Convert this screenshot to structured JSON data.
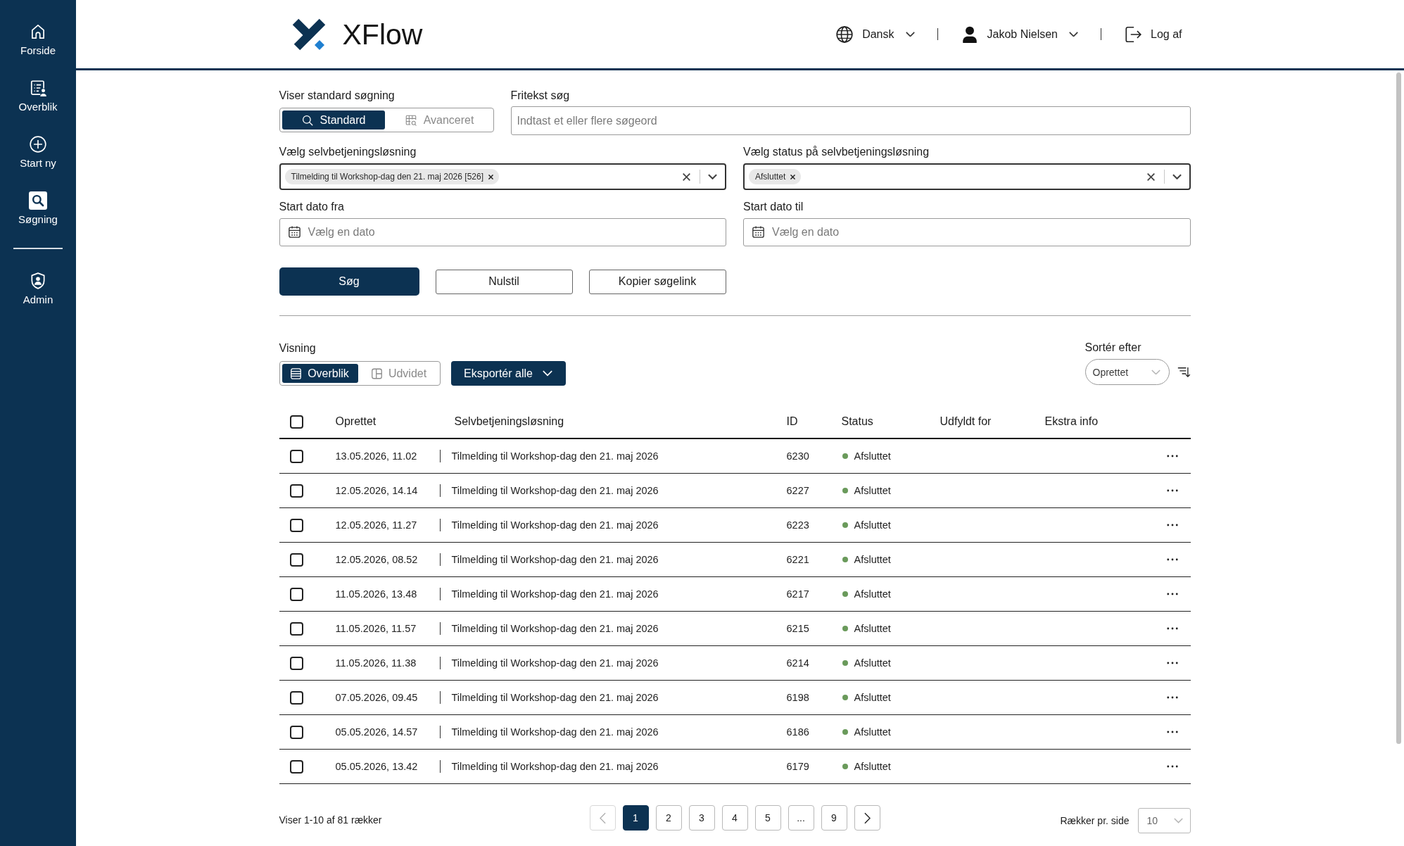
{
  "sidebar": {
    "items": [
      {
        "label": "Forside",
        "selected": false
      },
      {
        "label": "Overblik",
        "selected": false
      },
      {
        "label": "Start ny",
        "selected": false
      },
      {
        "label": "Søgning",
        "selected": true
      }
    ],
    "bottom_items": [
      {
        "label": "Admin",
        "selected": false
      }
    ]
  },
  "header": {
    "logo": "XFlow",
    "language": "Dansk",
    "user": "Jakob Nielsen",
    "logout": "Log af"
  },
  "search_form": {
    "mode_toggle": {
      "label": "Viser standard søgning",
      "options": [
        {
          "label": "Standard",
          "selected": true
        },
        {
          "label": "Avanceret",
          "selected": false
        }
      ]
    },
    "free_text": {
      "label": "Fritekst søg",
      "placeholder": "Indtast et eller flere søgeord"
    },
    "solution_select": {
      "label": "Vælg selvbetjeningsløsning",
      "chips": [
        "Tilmelding til Workshop-dag den 21. maj 2026 [526]"
      ]
    },
    "status_select": {
      "label": "Vælg status på selvbetjeningsløsning",
      "chips": [
        "Afsluttet"
      ]
    },
    "date_from": {
      "label": "Start dato fra",
      "placeholder": "Vælg en dato"
    },
    "date_to": {
      "label": "Start dato til",
      "placeholder": "Vælg en dato"
    },
    "buttons": [
      {
        "label": "Søg",
        "kind": "primary"
      },
      {
        "label": "Nulstil",
        "kind": "secondary"
      },
      {
        "label": "Kopier søgelink",
        "kind": "secondary"
      }
    ]
  },
  "results": {
    "view_toggle": {
      "label": "Visning",
      "options": [
        {
          "label": "Overblik",
          "selected": true
        },
        {
          "label": "Udvidet",
          "selected": false
        }
      ]
    },
    "export_button": "Eksportér alle",
    "sort": {
      "label": "Sortér efter",
      "value": "Oprettet"
    },
    "table": {
      "columns": [
        "Oprettet",
        "Selvbetjeningsløsning",
        "ID",
        "Status",
        "Udfyldt for",
        "Ekstra info"
      ],
      "all_checked": false,
      "rows": [
        {
          "checked": false,
          "created": "13.05.2026, 11.02",
          "solution": "Tilmelding til Workshop-dag den 21. maj 2026",
          "id": "6230",
          "status": "Afsluttet"
        },
        {
          "checked": false,
          "created": "12.05.2026, 14.14",
          "solution": "Tilmelding til Workshop-dag den 21. maj 2026",
          "id": "6227",
          "status": "Afsluttet"
        },
        {
          "checked": false,
          "created": "12.05.2026, 11.27",
          "solution": "Tilmelding til Workshop-dag den 21. maj 2026",
          "id": "6223",
          "status": "Afsluttet"
        },
        {
          "checked": false,
          "created": "12.05.2026, 08.52",
          "solution": "Tilmelding til Workshop-dag den 21. maj 2026",
          "id": "6221",
          "status": "Afsluttet"
        },
        {
          "checked": false,
          "created": "11.05.2026, 13.48",
          "solution": "Tilmelding til Workshop-dag den 21. maj 2026",
          "id": "6217",
          "status": "Afsluttet"
        },
        {
          "checked": false,
          "created": "11.05.2026, 11.57",
          "solution": "Tilmelding til Workshop-dag den 21. maj 2026",
          "id": "6215",
          "status": "Afsluttet"
        },
        {
          "checked": false,
          "created": "11.05.2026, 11.38",
          "solution": "Tilmelding til Workshop-dag den 21. maj 2026",
          "id": "6214",
          "status": "Afsluttet"
        },
        {
          "checked": false,
          "created": "07.05.2026, 09.45",
          "solution": "Tilmelding til Workshop-dag den 21. maj 2026",
          "id": "6198",
          "status": "Afsluttet"
        },
        {
          "checked": false,
          "created": "05.05.2026, 14.57",
          "solution": "Tilmelding til Workshop-dag den 21. maj 2026",
          "id": "6186",
          "status": "Afsluttet"
        },
        {
          "checked": false,
          "created": "05.05.2026, 13.42",
          "solution": "Tilmelding til Workshop-dag den 21. maj 2026",
          "id": "6179",
          "status": "Afsluttet"
        }
      ]
    }
  },
  "pagination": {
    "summary": "Viser 1-10 af 81 rækker",
    "prev": {
      "disabled": true
    },
    "pages": [
      {
        "label": "1",
        "selected": true
      },
      {
        "label": "2",
        "selected": false
      },
      {
        "label": "3",
        "selected": false
      },
      {
        "label": "4",
        "selected": false
      },
      {
        "label": "5",
        "selected": false
      },
      {
        "label": "...",
        "selected": false
      },
      {
        "label": "9",
        "selected": false
      }
    ],
    "next": {
      "disabled": false
    },
    "rows_per_page": {
      "label": "Rækker pr. side",
      "value": "10"
    }
  }
}
